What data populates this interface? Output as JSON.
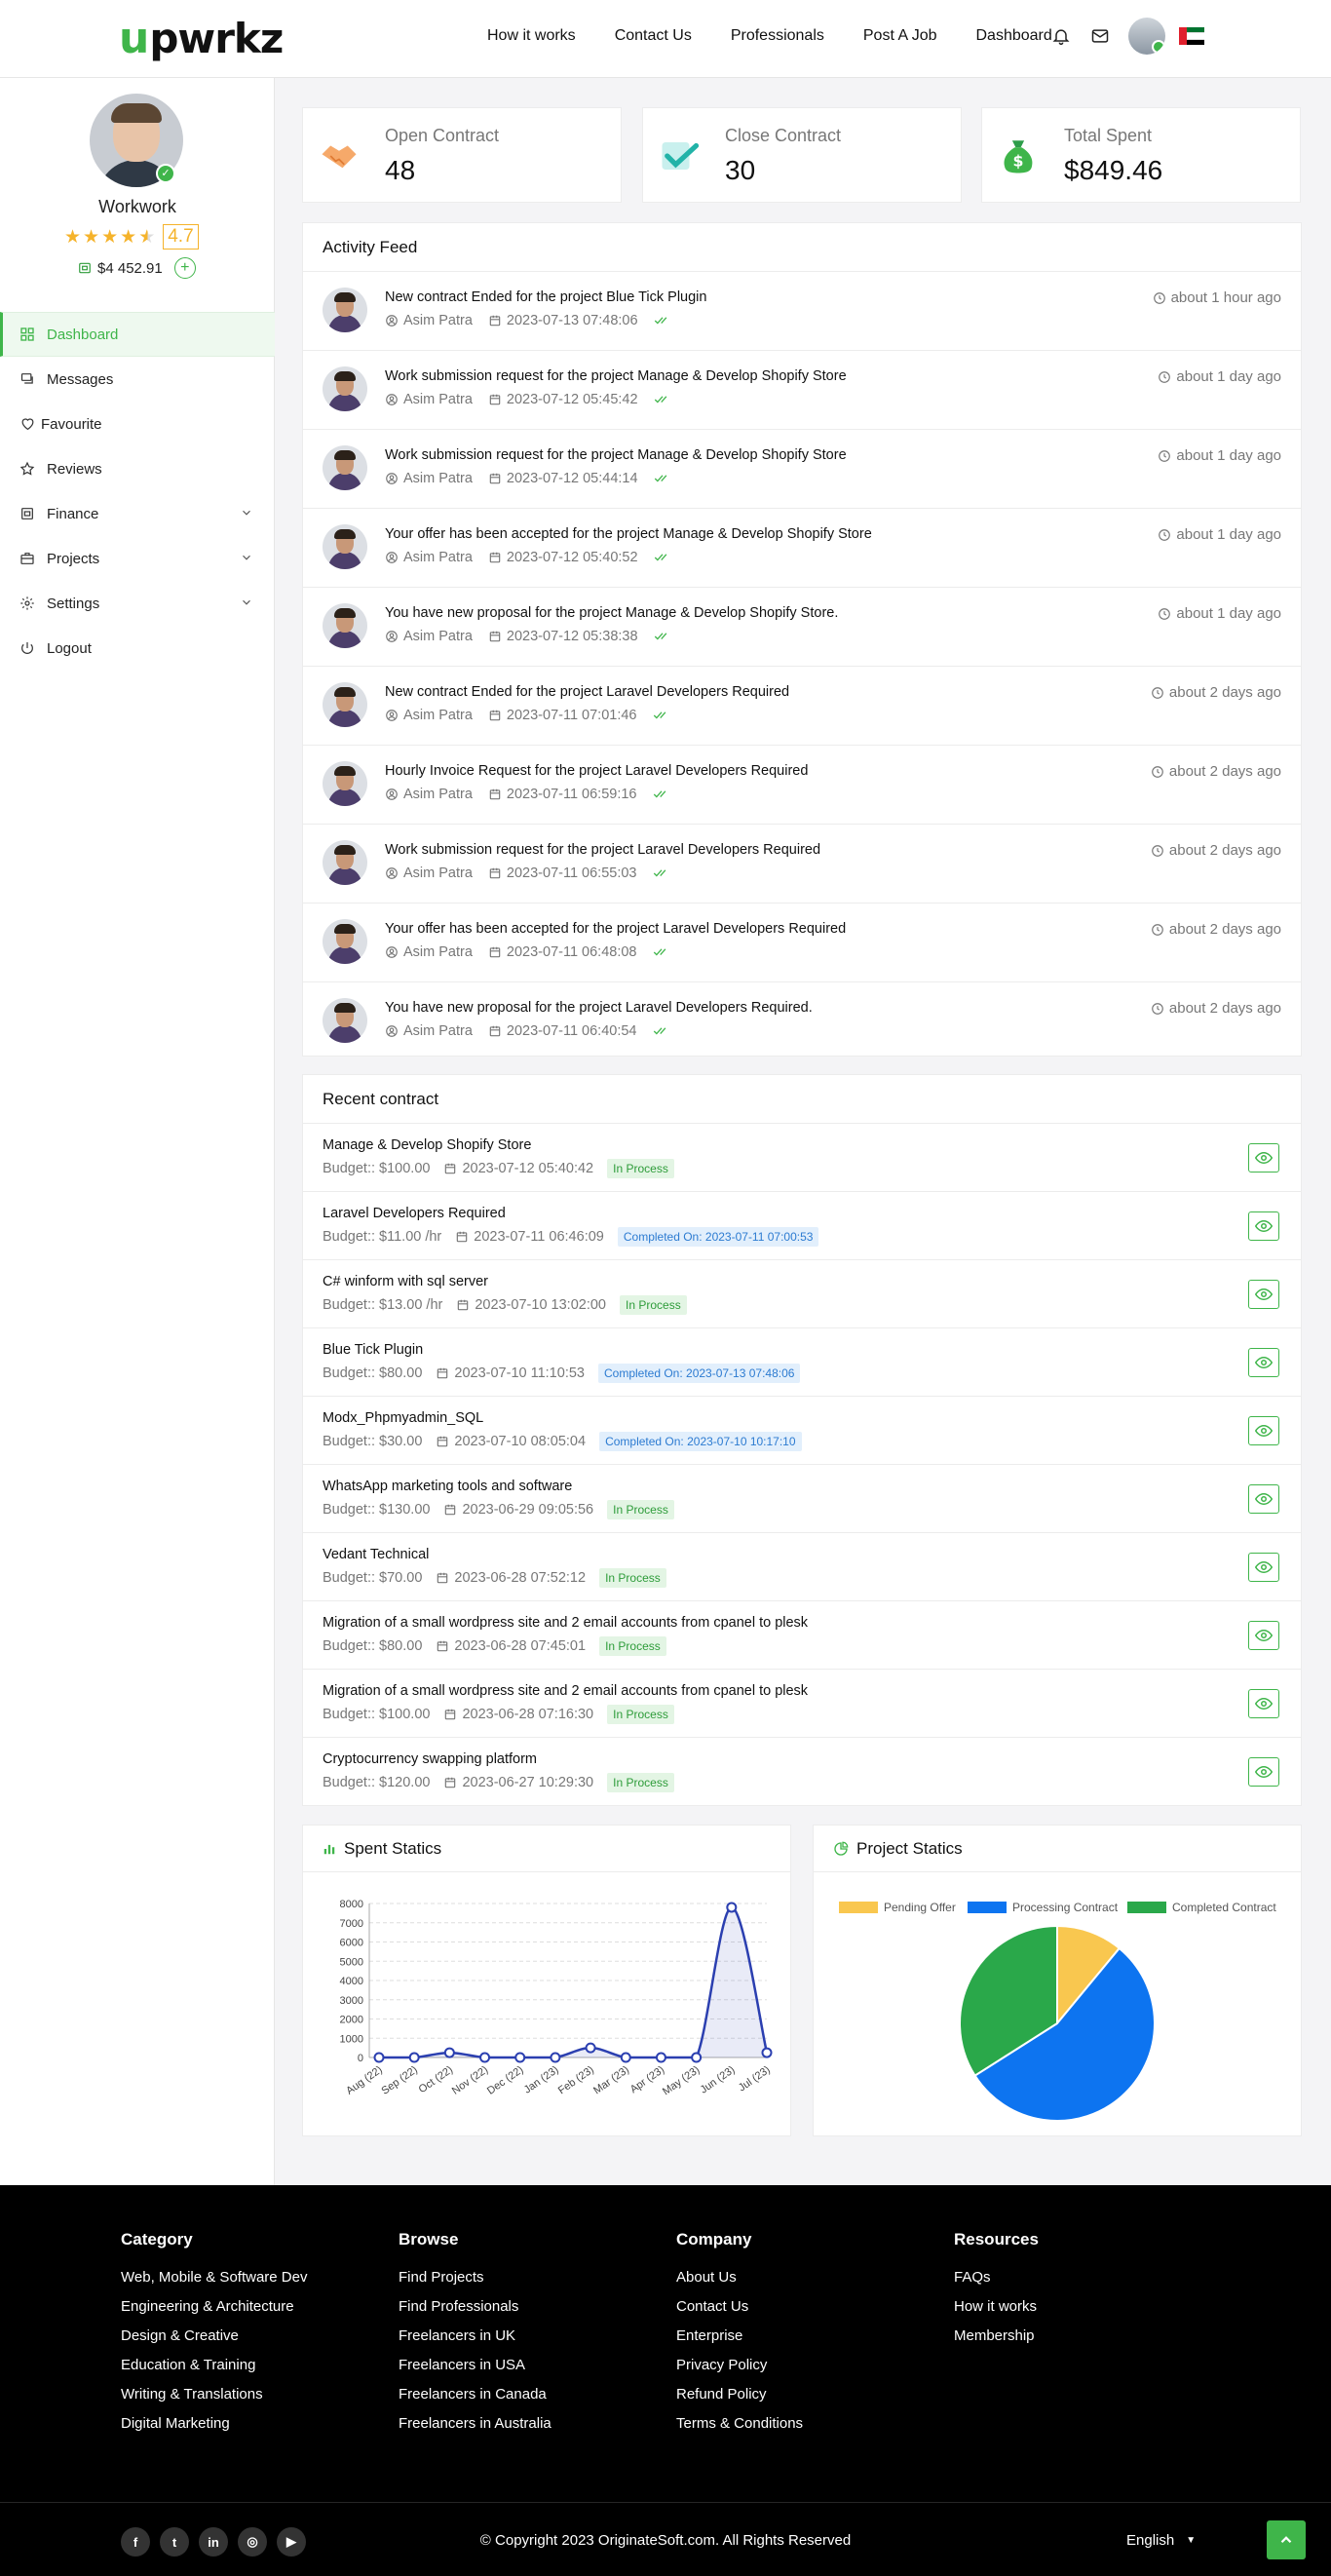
{
  "header": {
    "logo_u": "u",
    "logo_rest": "pwrkz",
    "nav": [
      "How it works",
      "Contact Us",
      "Professionals",
      "Post A Job",
      "Dashboard"
    ]
  },
  "sidebar": {
    "name": "Workwork",
    "rating": "4.7",
    "balance": "$4 452.91",
    "add_label": "+",
    "menu": [
      {
        "label": "Dashboard",
        "icon": "dashboard-icon",
        "active": true
      },
      {
        "label": "Messages",
        "icon": "messages-icon"
      },
      {
        "label": "Favourite",
        "icon": "heart-icon"
      },
      {
        "label": "Reviews",
        "icon": "star-icon"
      },
      {
        "label": "Finance",
        "icon": "finance-icon",
        "expandable": true
      },
      {
        "label": "Projects",
        "icon": "briefcase-icon",
        "expandable": true
      },
      {
        "label": "Settings",
        "icon": "gear-icon",
        "expandable": true
      },
      {
        "label": "Logout",
        "icon": "power-icon"
      }
    ]
  },
  "stats": [
    {
      "label": "Open Contract",
      "value": "48",
      "icon": "handshake-icon"
    },
    {
      "label": "Close Contract",
      "value": "30",
      "icon": "check-icon"
    },
    {
      "label": "Total Spent",
      "value": "$849.46",
      "icon": "money-bag-icon"
    }
  ],
  "activity": {
    "title": "Activity Feed",
    "items": [
      {
        "text": "New contract Ended for the project Blue Tick Plugin",
        "user": "Asim Patra",
        "date": "2023-07-13 07:48:06",
        "ago": "about 1 hour ago"
      },
      {
        "text": "Work submission request for the project Manage & Develop Shopify Store",
        "user": "Asim Patra",
        "date": "2023-07-12 05:45:42",
        "ago": "about 1 day ago"
      },
      {
        "text": "Work submission request for the project Manage & Develop Shopify Store",
        "user": "Asim Patra",
        "date": "2023-07-12 05:44:14",
        "ago": "about 1 day ago"
      },
      {
        "text": "Your offer has been accepted for the project Manage & Develop Shopify Store",
        "user": "Asim Patra",
        "date": "2023-07-12 05:40:52",
        "ago": "about 1 day ago"
      },
      {
        "text": "You have new proposal for the project Manage & Develop Shopify Store.",
        "user": "Asim Patra",
        "date": "2023-07-12 05:38:38",
        "ago": "about 1 day ago"
      },
      {
        "text": "New contract Ended for the project Laravel Developers Required",
        "user": "Asim Patra",
        "date": "2023-07-11 07:01:46",
        "ago": "about 2 days ago"
      },
      {
        "text": "Hourly Invoice Request for the project Laravel Developers Required",
        "user": "Asim Patra",
        "date": "2023-07-11 06:59:16",
        "ago": "about 2 days ago"
      },
      {
        "text": "Work submission request for the project Laravel Developers Required",
        "user": "Asim Patra",
        "date": "2023-07-11 06:55:03",
        "ago": "about 2 days ago"
      },
      {
        "text": "Your offer has been accepted for the project Laravel Developers Required",
        "user": "Asim Patra",
        "date": "2023-07-11 06:48:08",
        "ago": "about 2 days ago"
      },
      {
        "text": "You have new proposal for the project Laravel Developers Required.",
        "user": "Asim Patra",
        "date": "2023-07-11 06:40:54",
        "ago": "about 2 days ago"
      }
    ]
  },
  "contracts": {
    "title": "Recent contract",
    "items": [
      {
        "title": "Manage & Develop Shopify Store",
        "budget": "Budget:: $100.00",
        "date": "2023-07-12 05:40:42",
        "status": "In Process",
        "type": "proc"
      },
      {
        "title": "Laravel Developers Required",
        "budget": "Budget:: $11.00 /hr",
        "date": "2023-07-11 06:46:09",
        "status": "Completed On: 2023-07-11 07:00:53",
        "type": "done"
      },
      {
        "title": "C# winform with sql server",
        "budget": "Budget:: $13.00 /hr",
        "date": "2023-07-10 13:02:00",
        "status": "In Process",
        "type": "proc"
      },
      {
        "title": "Blue Tick Plugin",
        "budget": "Budget:: $80.00",
        "date": "2023-07-10 11:10:53",
        "status": "Completed On: 2023-07-13 07:48:06",
        "type": "done"
      },
      {
        "title": "Modx_Phpmyadmin_SQL",
        "budget": "Budget:: $30.00",
        "date": "2023-07-10 08:05:04",
        "status": "Completed On: 2023-07-10 10:17:10",
        "type": "done"
      },
      {
        "title": "WhatsApp marketing tools and software",
        "budget": "Budget:: $130.00",
        "date": "2023-06-29 09:05:56",
        "status": "In Process",
        "type": "proc"
      },
      {
        "title": "Vedant Technical",
        "budget": "Budget:: $70.00",
        "date": "2023-06-28 07:52:12",
        "status": "In Process",
        "type": "proc"
      },
      {
        "title": "Migration of a small wordpress site and 2 email accounts from cpanel to plesk",
        "budget": "Budget:: $80.00",
        "date": "2023-06-28 07:45:01",
        "status": "In Process",
        "type": "proc"
      },
      {
        "title": "Migration of a small wordpress site and 2 email accounts from cpanel to plesk",
        "budget": "Budget:: $100.00",
        "date": "2023-06-28 07:16:30",
        "status": "In Process",
        "type": "proc"
      },
      {
        "title": "Cryptocurrency swapping platform",
        "budget": "Budget:: $120.00",
        "date": "2023-06-27 10:29:30",
        "status": "In Process",
        "type": "proc"
      }
    ]
  },
  "chart_data": [
    {
      "type": "area",
      "title": "Spent Statics",
      "categories": [
        "Aug (22)",
        "Sep (22)",
        "Oct (22)",
        "Nov (22)",
        "Dec (22)",
        "Jan (23)",
        "Feb (23)",
        "Mar (23)",
        "Apr (23)",
        "May (23)",
        "Jun (23)",
        "Jul (23)"
      ],
      "values": [
        0,
        0,
        250,
        0,
        0,
        0,
        500,
        0,
        0,
        0,
        7800,
        250
      ],
      "ylim": [
        0,
        8000
      ],
      "yticks": [
        0,
        1000,
        2000,
        3000,
        4000,
        5000,
        6000,
        7000,
        8000
      ],
      "grid": true,
      "color": "#2b3fb0"
    },
    {
      "type": "pie",
      "title": "Project Statics",
      "legend_position": "top",
      "series": [
        {
          "name": "Pending Offer",
          "value": 11,
          "color": "#f9c74f"
        },
        {
          "name": "Processing Contract",
          "value": 55,
          "color": "#0d74f0"
        },
        {
          "name": "Completed Contract",
          "value": 34,
          "color": "#2aa84a"
        }
      ]
    }
  ],
  "footer": {
    "columns": [
      {
        "title": "Category",
        "links": [
          "Web, Mobile & Software Dev",
          "Engineering & Architecture",
          "Design & Creative",
          "Education & Training",
          "Writing & Translations",
          "Digital Marketing"
        ]
      },
      {
        "title": "Browse",
        "links": [
          "Find Projects",
          "Find Professionals",
          "Freelancers in UK",
          "Freelancers in USA",
          "Freelancers in Canada",
          "Freelancers in Australia"
        ]
      },
      {
        "title": "Company",
        "links": [
          "About Us",
          "Contact Us",
          "Enterprise",
          "Privacy Policy",
          "Refund Policy",
          "Terms & Conditions"
        ]
      },
      {
        "title": "Resources",
        "links": [
          "FAQs",
          "How it works",
          "Membership"
        ]
      }
    ],
    "socials": [
      {
        "name": "facebook-icon",
        "glyph": "f"
      },
      {
        "name": "twitter-icon",
        "glyph": "t"
      },
      {
        "name": "linkedin-icon",
        "glyph": "in"
      },
      {
        "name": "instagram-icon",
        "glyph": "◎"
      },
      {
        "name": "youtube-icon",
        "glyph": "▶"
      }
    ],
    "copyright": "© Copyright 2023 OriginateSoft.com. All Rights Reserved",
    "language": "English"
  },
  "colors": {
    "brand": "#3fb54a",
    "text": "#222222",
    "muted": "#777777"
  }
}
